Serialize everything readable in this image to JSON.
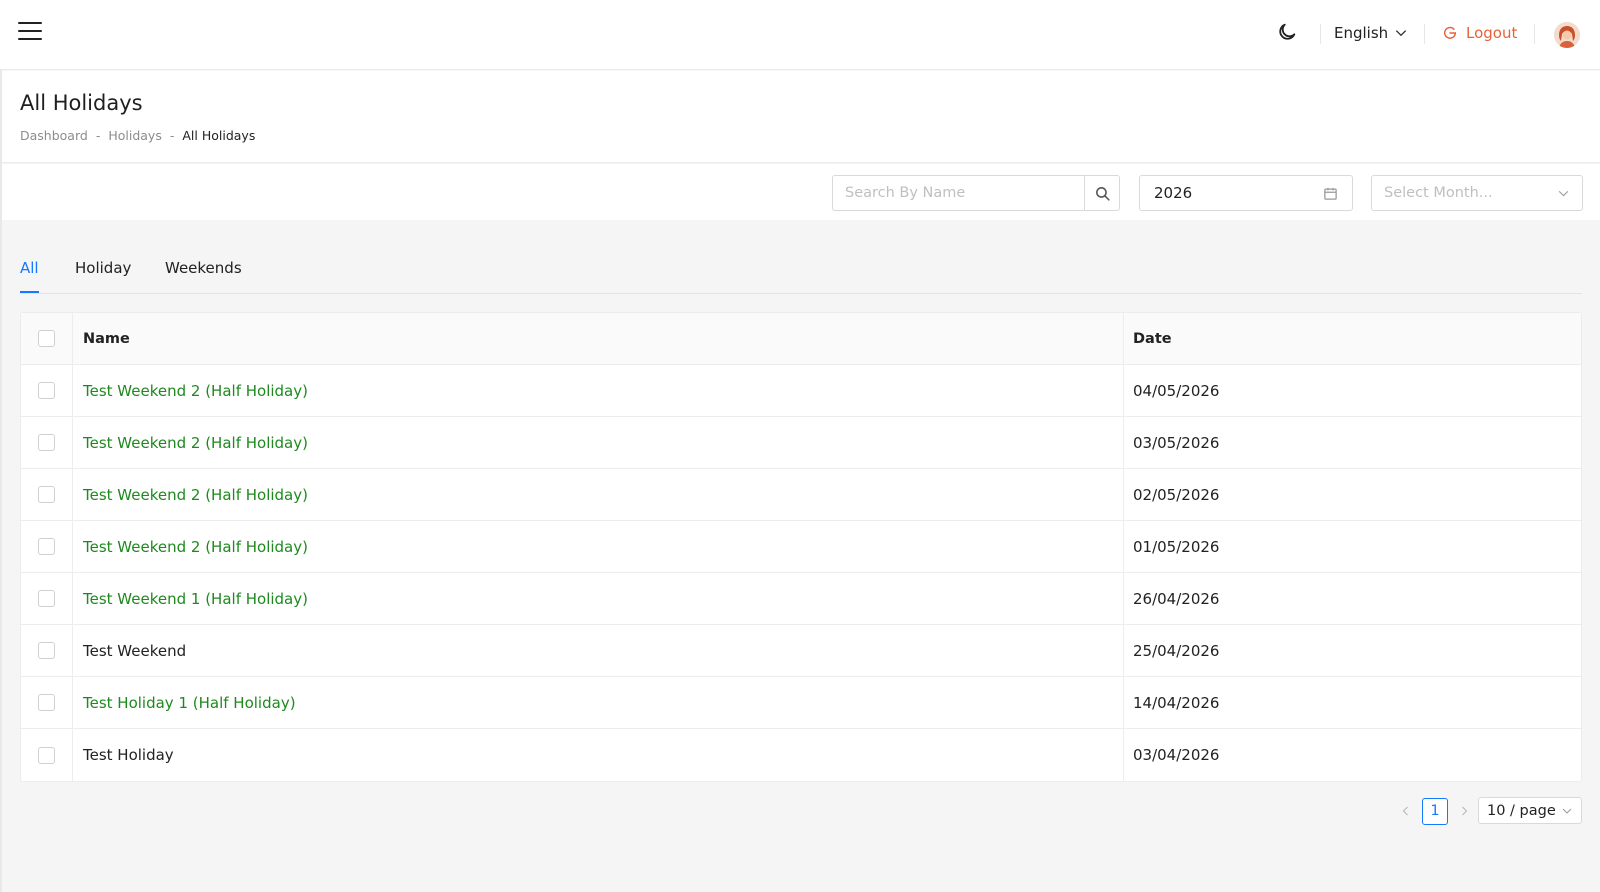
{
  "topbar": {
    "menu_icon": "hamburger-menu-icon",
    "theme_icon": "moon-icon",
    "language": "English",
    "logout_label": "Logout",
    "avatar_icon": "user-avatar"
  },
  "header": {
    "title": "All Holidays",
    "breadcrumb": [
      "Dashboard",
      "Holidays",
      "All Holidays"
    ],
    "breadcrumb_separator": "-"
  },
  "filters": {
    "search_placeholder": "Search By Name",
    "year_value": "2026",
    "month_placeholder": "Select Month..."
  },
  "tabs": [
    {
      "label": "All",
      "active": true
    },
    {
      "label": "Holiday",
      "active": false
    },
    {
      "label": "Weekends",
      "active": false
    }
  ],
  "table": {
    "columns": [
      "Name",
      "Date"
    ],
    "rows": [
      {
        "name": "Test Weekend 2 (Half Holiday)",
        "date": "04/05/2026",
        "half": true
      },
      {
        "name": "Test Weekend 2 (Half Holiday)",
        "date": "03/05/2026",
        "half": true
      },
      {
        "name": "Test Weekend 2 (Half Holiday)",
        "date": "02/05/2026",
        "half": true
      },
      {
        "name": "Test Weekend 2 (Half Holiday)",
        "date": "01/05/2026",
        "half": true
      },
      {
        "name": "Test Weekend 1 (Half Holiday)",
        "date": "26/04/2026",
        "half": true
      },
      {
        "name": "Test Weekend",
        "date": "25/04/2026",
        "half": false
      },
      {
        "name": "Test Holiday 1 (Half Holiday)",
        "date": "14/04/2026",
        "half": true
      },
      {
        "name": "Test Holiday",
        "date": "03/04/2026",
        "half": false
      }
    ]
  },
  "pagination": {
    "current_page": "1",
    "page_size": "10 / page"
  },
  "colors": {
    "accent": "#1677ff",
    "half_holiday_text": "#1e8a1e",
    "logout": "#e8623a"
  }
}
